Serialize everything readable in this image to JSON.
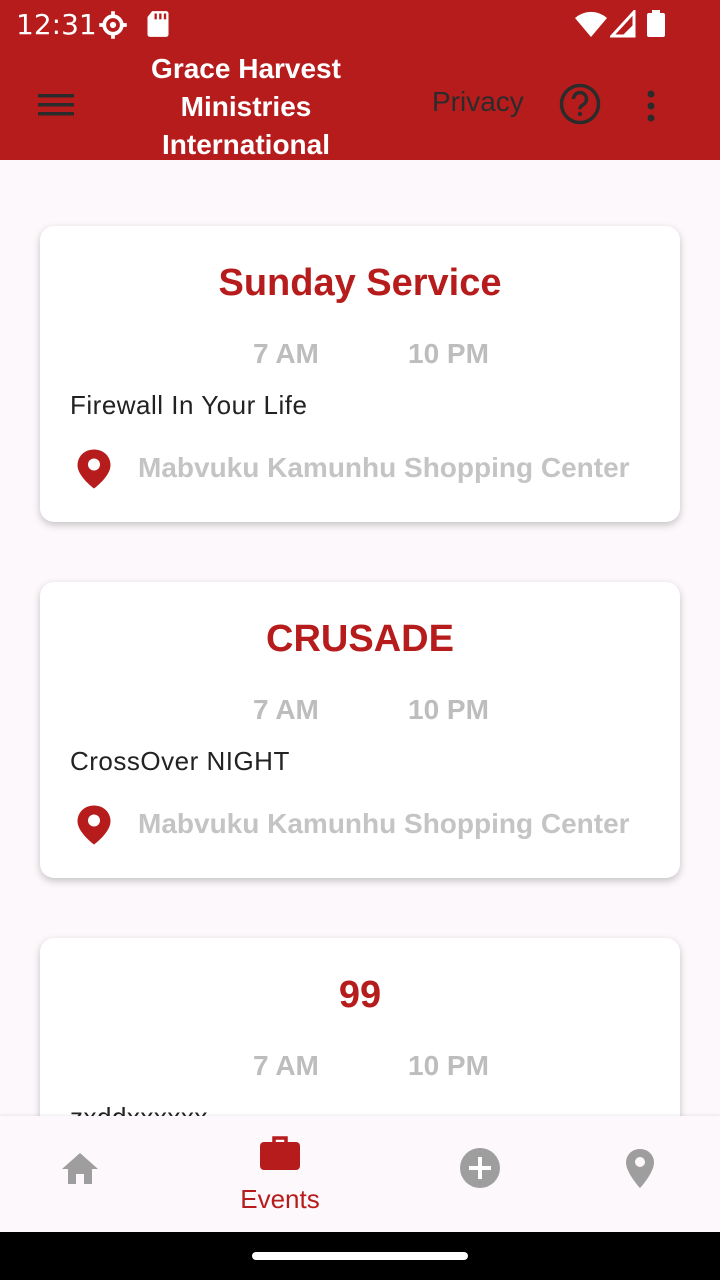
{
  "status_bar": {
    "time": "12:31",
    "icons": [
      "settings-icon",
      "sd-card-icon",
      "wifi-icon",
      "signal-icon",
      "battery-icon"
    ]
  },
  "app_bar": {
    "title": "Grace Harvest Ministries International",
    "privacy_label": "Privacy",
    "icons": [
      "menu-icon",
      "help-icon",
      "more-vert-icon"
    ]
  },
  "events": [
    {
      "title": "Sunday Service",
      "start": "7 AM",
      "end": "10 PM",
      "description": "Firewall In Your Life",
      "location": "Mabvuku Kamunhu Shopping Center"
    },
    {
      "title": "CRUSADE",
      "start": "7 AM",
      "end": "10 PM",
      "description": "CrossOver NIGHT",
      "location": "Mabvuku Kamunhu Shopping Center"
    },
    {
      "title": "99",
      "start": "7 AM",
      "end": "10 PM",
      "description": "zxddxxxxxx",
      "location": ""
    }
  ],
  "bottom_nav": {
    "items": [
      {
        "icon": "home-icon",
        "label": ""
      },
      {
        "icon": "briefcase-icon",
        "label": "Events"
      },
      {
        "icon": "add-circle-icon",
        "label": ""
      },
      {
        "icon": "location-icon",
        "label": ""
      }
    ],
    "active_index": 1
  },
  "colors": {
    "primary": "#b71c1c",
    "inactive": "#9e9e9e",
    "muted_text": "#bdbdbd",
    "background": "#fcf8fb"
  }
}
